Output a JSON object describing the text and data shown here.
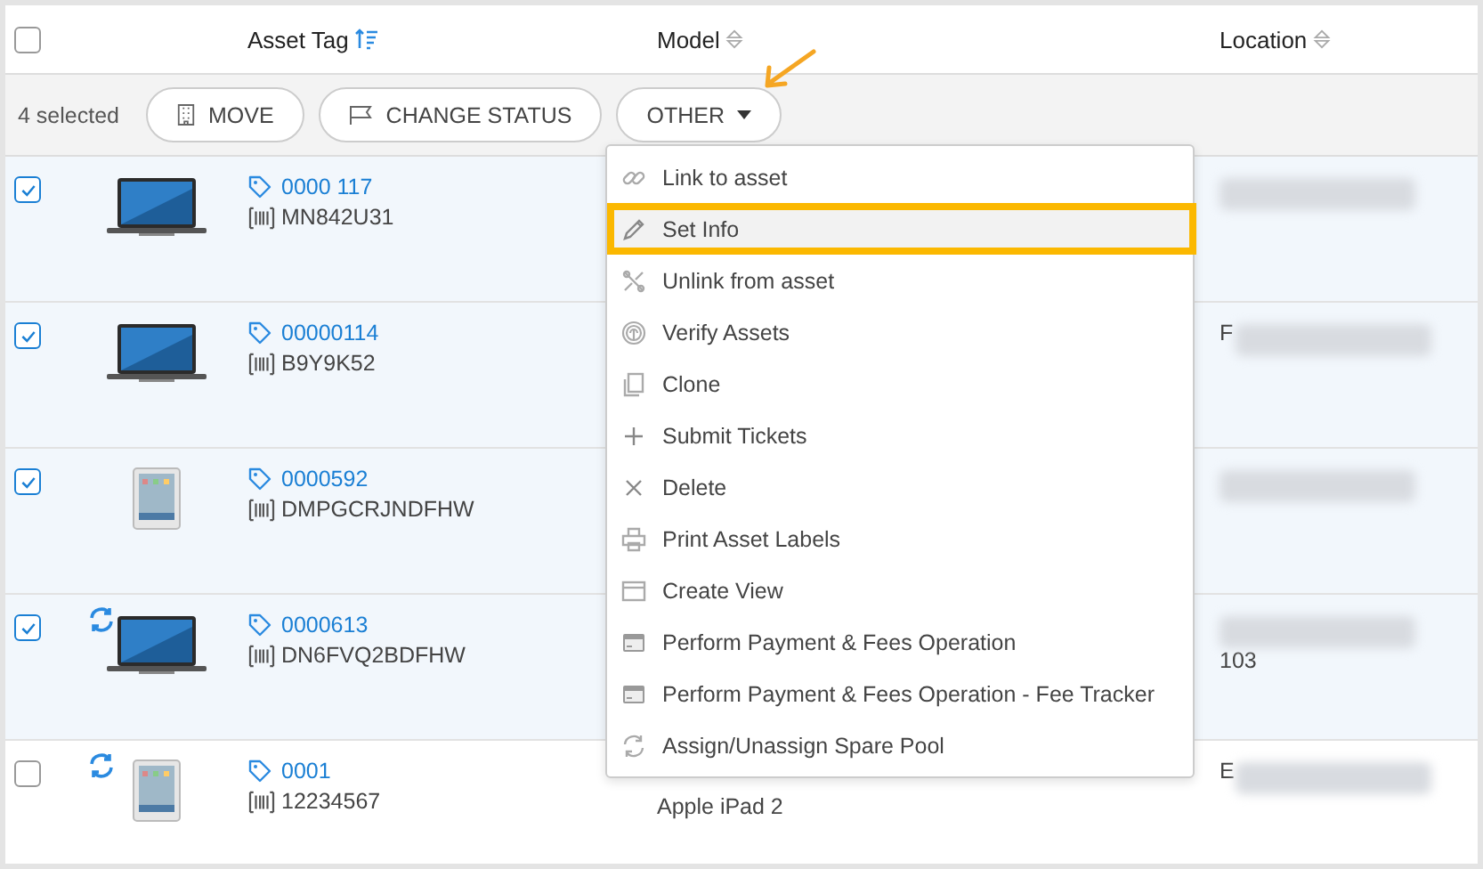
{
  "header": {
    "select_all": {
      "checked": false
    },
    "columns": [
      {
        "label": "Asset Tag",
        "sorted": true
      },
      {
        "label": "Model",
        "sorted": false
      },
      {
        "label": "Location",
        "sorted": false
      }
    ]
  },
  "toolbar": {
    "count": "4 selected",
    "buttons": [
      {
        "label": "MOVE",
        "kind": "building"
      },
      {
        "label": "CHANGE STATUS",
        "kind": "flag"
      },
      {
        "label": "OTHER",
        "kind": "dropdown"
      }
    ]
  },
  "rows": [
    {
      "selected": true,
      "sync": false,
      "kind": "laptop",
      "tag": "0000 117",
      "serial": "MN842U31"
    },
    {
      "selected": true,
      "sync": false,
      "kind": "laptop",
      "tag": "00000114",
      "serial": "B9Y9K52",
      "location": {
        "text": "F",
        "kind": "inline"
      }
    },
    {
      "selected": true,
      "sync": false,
      "kind": "tablet",
      "tag": "0000592",
      "serial": "DMPGCRJNDFHW"
    },
    {
      "selected": true,
      "sync": true,
      "kind": "laptop",
      "tag": "0000613",
      "serial": "DN6FVQ2BDFHW",
      "location": {
        "text": "103",
        "kind": "below"
      }
    },
    {
      "selected": false,
      "sync": true,
      "kind": "tablet",
      "tag": "0001",
      "serial": "12234567",
      "model": "Apple iPad 2",
      "location": {
        "text": "E",
        "kind": "inline"
      }
    }
  ],
  "menu": {
    "items": [
      {
        "label": "Link to asset",
        "kind": "link",
        "selected": false
      },
      {
        "label": "Set Info",
        "kind": "edit",
        "selected": true
      },
      {
        "label": "Unlink from asset",
        "kind": "unlink",
        "selected": false
      },
      {
        "label": "Verify Assets",
        "kind": "fingerprint",
        "selected": false
      },
      {
        "label": "Clone",
        "kind": "copy",
        "selected": false
      },
      {
        "label": "Submit Tickets",
        "kind": "plus",
        "selected": false
      },
      {
        "label": "Delete",
        "kind": "close",
        "selected": false
      },
      {
        "label": "Print Asset Labels",
        "kind": "printer",
        "selected": false
      },
      {
        "label": "Create View",
        "kind": "window",
        "selected": false
      },
      {
        "label": "Perform Payment & Fees Operation",
        "kind": "card",
        "selected": false
      },
      {
        "label": "Perform Payment & Fees Operation - Fee Tracker",
        "kind": "card",
        "selected": false
      },
      {
        "label": "Assign/Unassign Spare Pool",
        "kind": "refresh",
        "selected": false
      }
    ]
  }
}
